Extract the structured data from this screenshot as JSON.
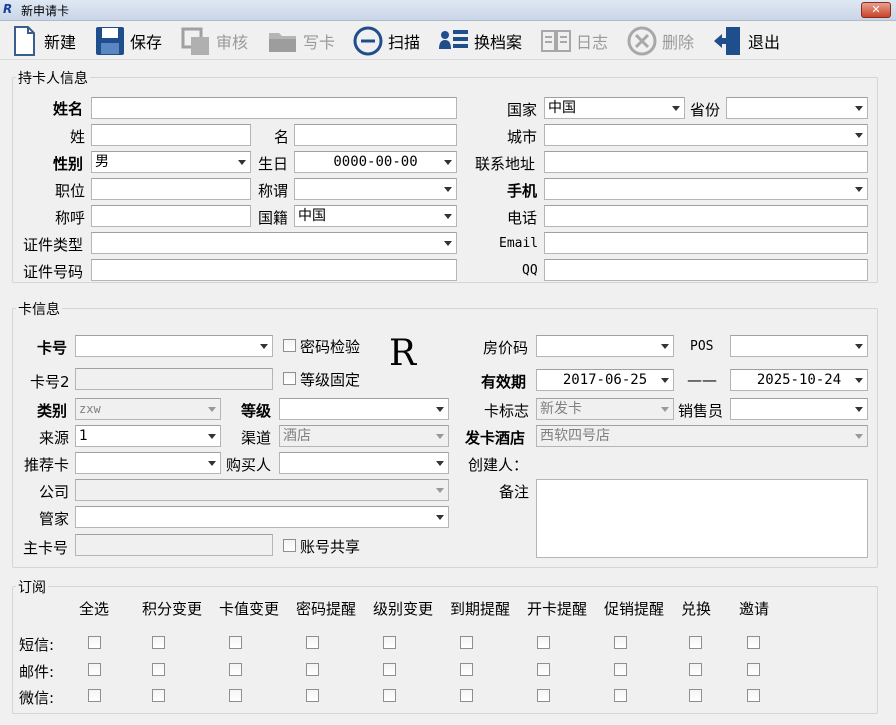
{
  "window": {
    "title": "新申请卡",
    "logo_text": "R",
    "close_label": "✕"
  },
  "toolbar": {
    "new": "新建",
    "save": "保存",
    "audit": "审核",
    "write_card": "写卡",
    "scan": "扫描",
    "switch_profile": "换档案",
    "log": "日志",
    "delete": "删除",
    "exit": "退出"
  },
  "holder": {
    "section_title": "持卡人信息",
    "full_name_label": "姓名",
    "full_name": "",
    "surname_label": "姓",
    "surname": "",
    "given_label": "名",
    "given": "",
    "gender_label": "性别",
    "gender": "男",
    "birthday_label": "生日",
    "birthday": "0000-00-00",
    "position_label": "职位",
    "position": "",
    "title_label": "称谓",
    "title_val": "",
    "salutation_label": "称呼",
    "salutation": "",
    "nationality_label": "国籍",
    "nationality": "中国",
    "id_type_label": "证件类型",
    "id_type": "",
    "id_no_label": "证件号码",
    "id_no": "",
    "country_label": "国家",
    "country": "中国",
    "province_label": "省份",
    "province": "",
    "city_label": "城市",
    "city": "",
    "address_label": "联系地址",
    "address": "",
    "mobile_label": "手机",
    "mobile": "",
    "phone_label": "电话",
    "phone": "",
    "email_label": "Email",
    "email": "",
    "qq_label": "QQ",
    "qq": ""
  },
  "card": {
    "section_title": "卡信息",
    "card_no_label": "卡号",
    "card_no": "",
    "pwd_check_label": "密码检验",
    "card_no2_label": "卡号2",
    "card_no2": "",
    "level_fixed_label": "等级固定",
    "type_label": "类别",
    "type": "zxw",
    "level_label": "等级",
    "level": "",
    "source_label": "来源",
    "source": "1",
    "channel_label": "渠道",
    "channel": "酒店",
    "referrer_label": "推荐卡",
    "referrer": "",
    "buyer_label": "购买人",
    "buyer": "",
    "company_label": "公司",
    "company": "",
    "steward_label": "管家",
    "steward": "",
    "main_card_label": "主卡号",
    "main_card": "",
    "account_share_label": "账号共享",
    "big_r": "R",
    "rate_code_label": "房价码",
    "rate_code": "",
    "pos_label": "POS",
    "pos": "",
    "validity_label": "有效期",
    "valid_from": "2017-06-25",
    "valid_sep": "——",
    "valid_to": "2025-10-24",
    "card_flag_label": "卡标志",
    "card_flag": "新发卡",
    "salesman_label": "销售员",
    "salesman": "",
    "issuing_hotel_label": "发卡酒店",
    "issuing_hotel": "西软四号店",
    "creator_label": "创建人：",
    "creator": "",
    "remark_label": "备注",
    "remark": ""
  },
  "subscribe": {
    "section_title": "订阅",
    "columns": [
      "全选",
      "积分变更",
      "卡值变更",
      "密码提醒",
      "级别变更",
      "到期提醒",
      "开卡提醒",
      "促销提醒",
      "兑换",
      "邀请"
    ],
    "rows": [
      "短信:",
      "邮件:",
      "微信:"
    ]
  }
}
